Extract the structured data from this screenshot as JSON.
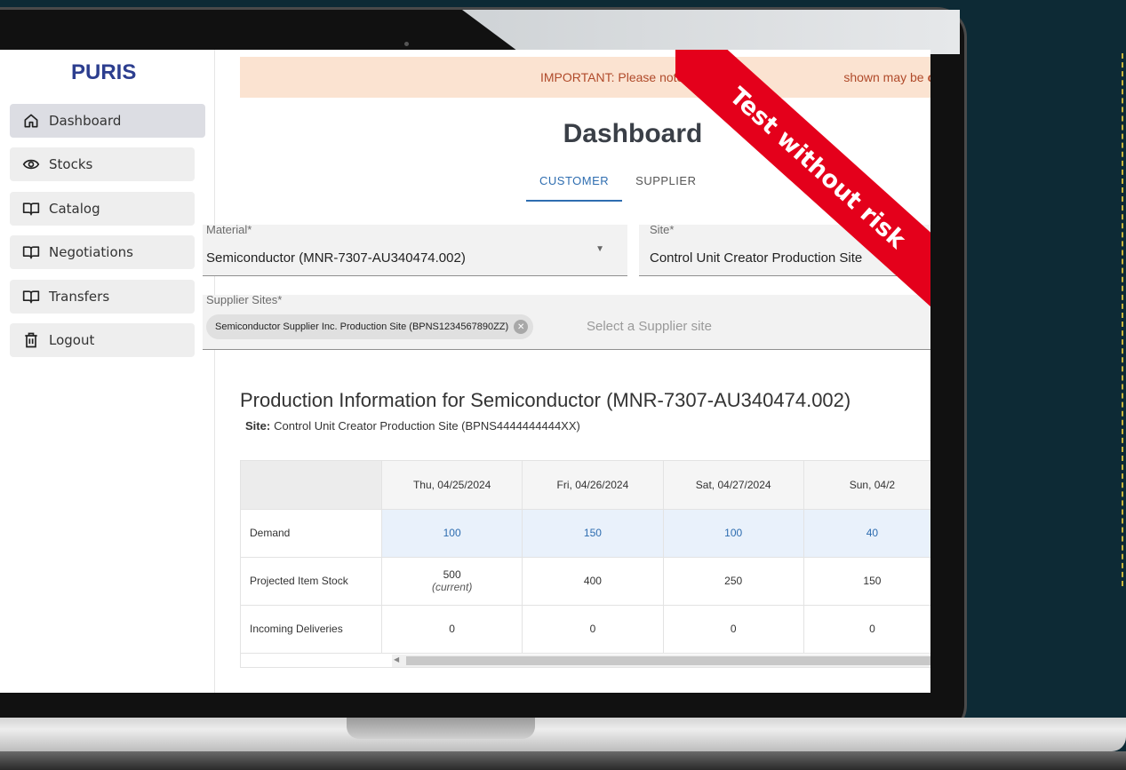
{
  "app": {
    "brand": "PURIS"
  },
  "sidebar": {
    "items": [
      {
        "label": "Dashboard",
        "icon": "home-icon"
      },
      {
        "label": "Stocks",
        "icon": "eye-icon"
      },
      {
        "label": "Catalog",
        "icon": "book-icon"
      },
      {
        "label": "Negotiations",
        "icon": "book-icon"
      },
      {
        "label": "Transfers",
        "icon": "book-icon"
      },
      {
        "label": "Logout",
        "icon": "trash-icon"
      }
    ]
  },
  "banner": {
    "text": "IMPORTANT: Please note",
    "text_tail": "shown may be",
    "bold": "competit"
  },
  "page": {
    "title": "Dashboard"
  },
  "tabs": {
    "customer": "CUSTOMER",
    "supplier": "SUPPLIER"
  },
  "filters": {
    "material": {
      "label": "Material*",
      "value": "Semiconductor (MNR-7307-AU340474.002)"
    },
    "site": {
      "label": "Site*",
      "value": "Control Unit Creator Production Site"
    },
    "supplier_sites": {
      "label": "Supplier Sites*",
      "chip": "Semiconductor Supplier Inc. Production Site (BPNS1234567890ZZ)",
      "placeholder": "Select a Supplier site"
    }
  },
  "production": {
    "title": "Production Information for Semiconductor (MNR-7307-AU340474.002)",
    "site_label": "Site:",
    "site_value": "Control Unit Creator Production Site (BPNS4444444444XX)",
    "columns": [
      "Thu, 04/25/2024",
      "Fri, 04/26/2024",
      "Sat, 04/27/2024",
      "Sun, 04/2"
    ],
    "rows": [
      {
        "label": "Demand",
        "values": [
          "100",
          "150",
          "100",
          "40"
        ]
      },
      {
        "label": "Projected Item Stock",
        "values": [
          "500",
          "400",
          "250",
          "150"
        ],
        "note": "(current)"
      },
      {
        "label": "Incoming Deliveries",
        "values": [
          "0",
          "0",
          "0",
          "0"
        ]
      }
    ]
  },
  "ribbon": {
    "text": "Test without risk",
    "color": "#e4001b"
  }
}
